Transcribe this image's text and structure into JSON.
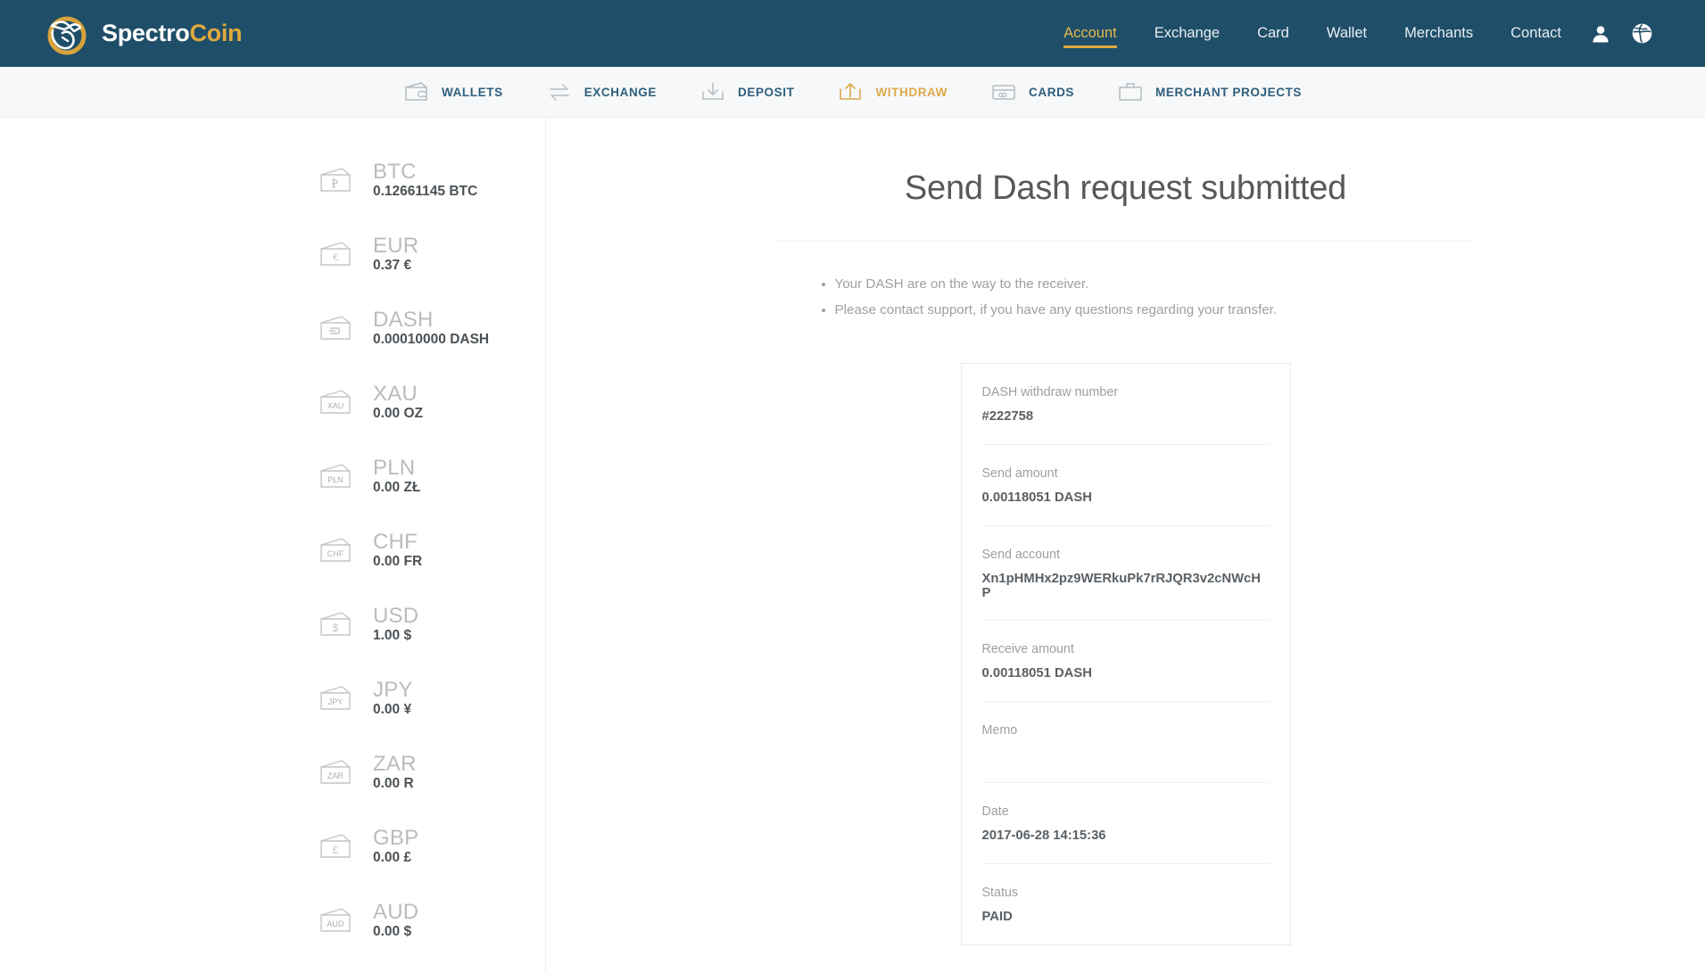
{
  "brand": {
    "name_white": "Spectro",
    "name_gold": "Coin"
  },
  "header": {
    "nav": [
      {
        "label": "Account",
        "active": true
      },
      {
        "label": "Exchange",
        "active": false
      },
      {
        "label": "Card",
        "active": false
      },
      {
        "label": "Wallet",
        "active": false
      },
      {
        "label": "Merchants",
        "active": false
      },
      {
        "label": "Contact",
        "active": false
      }
    ],
    "icons": [
      {
        "name": "user-account-icon"
      },
      {
        "name": "globe-language-icon"
      }
    ],
    "bg_color": "#1f4e68",
    "accent_color": "#e0a93e"
  },
  "subnav": {
    "items": [
      {
        "label": "WALLETS",
        "icon": "wallet-icon",
        "active": false
      },
      {
        "label": "EXCHANGE",
        "icon": "exchange-arrows-icon",
        "active": false
      },
      {
        "label": "DEPOSIT",
        "icon": "deposit-download-icon",
        "active": false
      },
      {
        "label": "WITHDRAW",
        "icon": "withdraw-upload-icon",
        "active": true
      },
      {
        "label": "CARDS",
        "icon": "credit-card-icon",
        "active": false
      },
      {
        "label": "MERCHANT PROJECTS",
        "icon": "briefcase-icon",
        "active": false
      }
    ],
    "active_color": "#dca94a",
    "inactive_color": "#2e5f7d"
  },
  "sidebar": {
    "wallets": [
      {
        "code": "BTC",
        "amount": "0.12661145 BTC",
        "symbol": "Ƀ"
      },
      {
        "code": "EUR",
        "amount": "0.37 €",
        "symbol": "€"
      },
      {
        "code": "DASH",
        "amount": "0.00010000 DASH",
        "symbol": "D"
      },
      {
        "code": "XAU",
        "amount": "0.00 OZ",
        "symbol": "XAU"
      },
      {
        "code": "PLN",
        "amount": "0.00 ZŁ",
        "symbol": "PLN"
      },
      {
        "code": "CHF",
        "amount": "0.00 FR",
        "symbol": "CHF"
      },
      {
        "code": "USD",
        "amount": "1.00 $",
        "symbol": "$"
      },
      {
        "code": "JPY",
        "amount": "0.00 ¥",
        "symbol": "JPY"
      },
      {
        "code": "ZAR",
        "amount": "0.00 R",
        "symbol": "ZAR"
      },
      {
        "code": "GBP",
        "amount": "0.00 £",
        "symbol": "£"
      },
      {
        "code": "AUD",
        "amount": "0.00 $",
        "symbol": "AUD"
      }
    ]
  },
  "main": {
    "title": "Send Dash request submitted",
    "notes": [
      "Your DASH are on the way to the receiver.",
      "Please contact support, if you have any questions regarding your transfer."
    ],
    "details": [
      {
        "label": "DASH withdraw number",
        "value": "#222758"
      },
      {
        "label": "Send amount",
        "value": "0.00118051 DASH"
      },
      {
        "label": "Send account",
        "value": "Xn1pHMHx2pz9WERkuPk7rRJQR3v2cNWcHP"
      },
      {
        "label": "Receive amount",
        "value": "0.00118051 DASH"
      },
      {
        "label": "Memo",
        "value": ""
      },
      {
        "label": "Date",
        "value": "2017-06-28 14:15:36"
      },
      {
        "label": "Status",
        "value": "PAID"
      }
    ]
  }
}
